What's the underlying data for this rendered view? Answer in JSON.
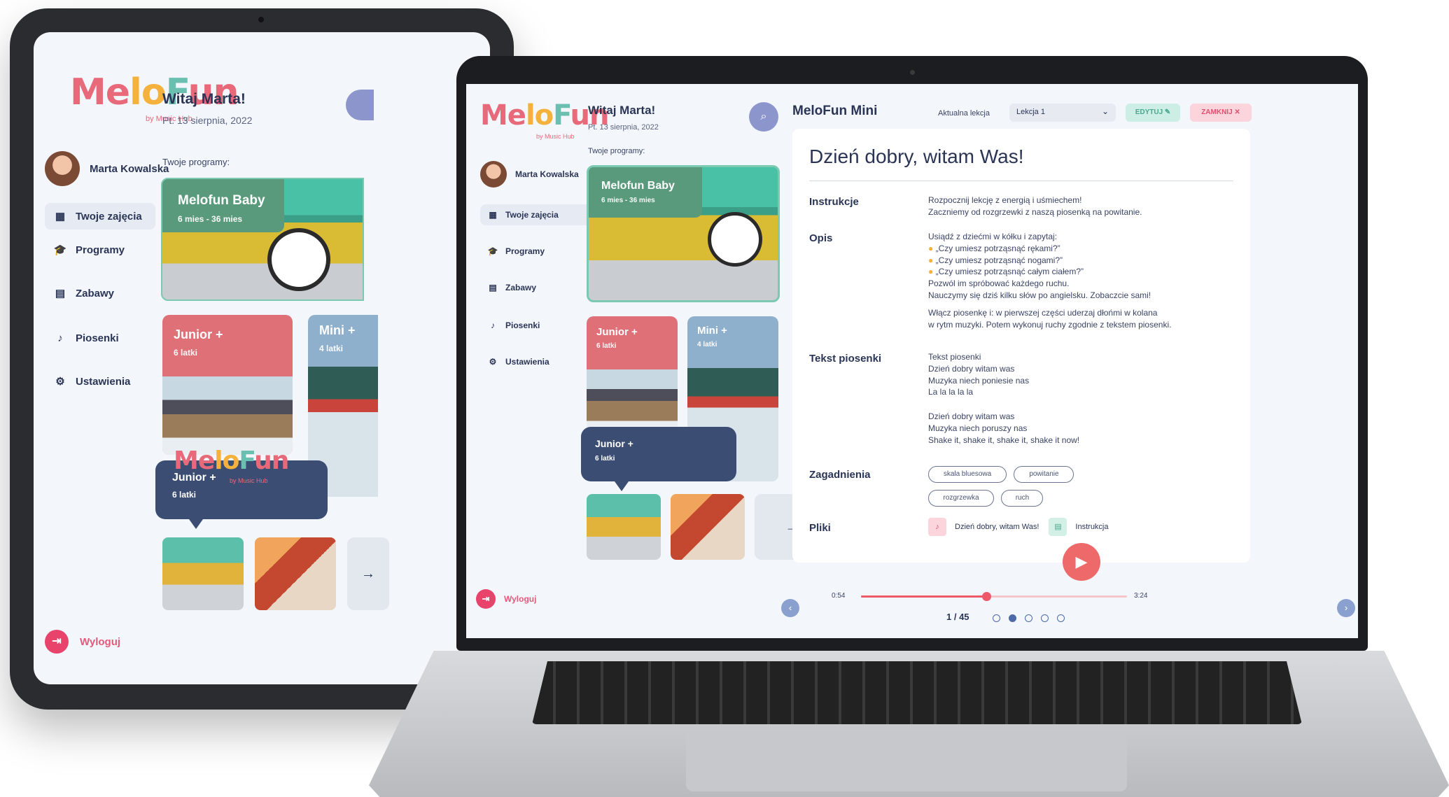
{
  "brand": {
    "logo_parts": [
      "Me",
      "lo",
      "F",
      "un"
    ],
    "logo_sub": "by Music Hub"
  },
  "user": {
    "greeting": "Witaj Marta!",
    "date": "Pt. 13 sierpnia, 2022",
    "name": "Marta Kowalska"
  },
  "programs_label": "Twoje programy:",
  "nav": [
    {
      "label": "Twoje zajęcia",
      "icon": "grid-icon"
    },
    {
      "label": "Programy",
      "icon": "graduation-cap-icon"
    },
    {
      "label": "Zabawy",
      "icon": "document-icon"
    },
    {
      "label": "Piosenki",
      "icon": "music-note-icon"
    },
    {
      "label": "Ustawienia",
      "icon": "gear-icon"
    }
  ],
  "logout_label": "Wyloguj",
  "cards": {
    "baby": {
      "title": "Melofun Baby",
      "sub": "6 mies - 36 mies"
    },
    "junior": {
      "title": "Junior +",
      "sub": "6 latki"
    },
    "mini": {
      "title": "Mini +",
      "sub": "4 latki"
    },
    "tooltip": {
      "title": "Junior +",
      "sub": "6 latki"
    }
  },
  "lesson": {
    "program": "MeloFun Mini",
    "current_label": "Aktualna lekcja",
    "current_value": "Lekcja 1",
    "edit_label": "EDYTUJ",
    "close_label": "ZAMKNIJ",
    "title": "Dzień dobry, witam Was!",
    "instructions_label": "Instrukcje",
    "instructions": [
      "Rozpocznij lekcję z energią i uśmiechem!",
      "Zaczniemy od rozgrzewki z naszą piosenką na powitanie."
    ],
    "desc_label": "Opis",
    "desc": [
      "Usiądź z dziećmi w kółku i zapytaj:",
      "„Czy umiesz potrząsnąć rękami?”",
      "„Czy umiesz potrząsnąć nogami?”",
      "„Czy umiesz potrząsnąć całym ciałem?”",
      "Pozwól im spróbować każdego ruchu.",
      "Nauczymy się dziś kilku słów po angielsku. Zobaczcie sami!",
      "Włącz piosenkę i: w pierwszej części uderzaj dłońmi w kolana",
      "w rytm muzyki. Potem wykonuj ruchy zgodnie z tekstem piosenki."
    ],
    "lyrics_label": "Tekst piosenki",
    "lyrics": [
      "Tekst piosenki",
      "Dzień dobry witam was",
      "Muzyka niech poniesie nas",
      "La la la la la",
      "",
      "Dzień dobry witam was",
      "Muzyka niech poruszy nas",
      "Shake it, shake it, shake it, shake it now!"
    ],
    "topics_label": "Zagadnienia",
    "topics": [
      "skala bluesowa",
      "powitanie",
      "rozgrzewka",
      "ruch"
    ],
    "files_label": "Pliki",
    "files": [
      "Dzień dobry, witam Was!",
      "Instrukcja"
    ],
    "time_current": "0:54",
    "time_total": "3:24",
    "progress": 0.47,
    "page": "1 / 45"
  },
  "colors": {
    "accent_red": "#e8436b",
    "navy": "#3b4d72",
    "teal": "#4aa88d",
    "baby_green": "#5a9a7c",
    "junior_red": "#e07078",
    "mini_blue": "#8fb0cc"
  }
}
